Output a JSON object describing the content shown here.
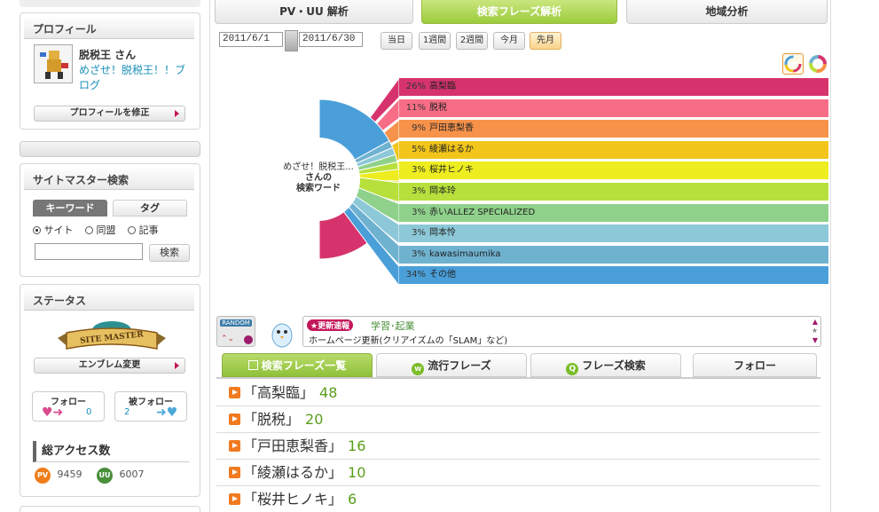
{
  "top_tabs": [
    {
      "label": "PV・UU 解析"
    },
    {
      "label": "検索フレーズ解析"
    },
    {
      "label": "地域分析"
    }
  ],
  "profile": {
    "title": "プロフィール",
    "name": "脱税王 さん",
    "blog_link": "めざせ！脱税王！！ブログ",
    "edit_button": "プロフィールを修正"
  },
  "sitemaster": {
    "title": "サイトマスター検索",
    "tab_keyword": "キーワード",
    "tab_tag": "タグ",
    "radio_site": "サイト",
    "radio_doumei": "同盟",
    "radio_kiji": "記事",
    "search_button": "検索",
    "search_value": ""
  },
  "status": {
    "title": "ステータス",
    "emblem_text": "SITE MASTER",
    "emblem_button": "エンブレム変更",
    "follow_label": "フォロー",
    "follow_count": "0",
    "followed_label": "被フォロー",
    "followed_count": "2",
    "access_title": "総アクセス数",
    "pv_badge": "PV",
    "pv_count": "9459",
    "uu_badge": "UU",
    "uu_count": "6007"
  },
  "date_range": {
    "from": "2011/6/1",
    "to": "2011/6/30"
  },
  "period_buttons": [
    "当日",
    "1週間",
    "2週間",
    "今月",
    "先月"
  ],
  "chart_center": {
    "line1": "めざせ！脱税王...",
    "line2": "さんの",
    "line3": "検索ワード"
  },
  "chart_data": {
    "type": "bar",
    "categories": [
      "高梨臨",
      "脱税",
      "戸田恵梨香",
      "綾瀬はるか",
      "桜井ヒノキ",
      "岡本玲",
      "赤いALLEZ SPECIALIZED",
      "岡本怜",
      "kawasimaumika",
      "その他"
    ],
    "values": [
      26,
      11,
      9,
      5,
      3,
      3,
      3,
      3,
      3,
      34
    ],
    "value_labels": [
      "26%",
      "11%",
      "9%",
      "5%",
      "3%",
      "3%",
      "3%",
      "3%",
      "3%",
      "34%"
    ],
    "colors": [
      "#d6336c",
      "#f76d85",
      "#f7924a",
      "#f2c51a",
      "#eded1f",
      "#b7e03c",
      "#8fd18b",
      "#8cc8d8",
      "#6fb2d0",
      "#4a9fd9"
    ]
  },
  "random": {
    "label": "RANDOM",
    "badge": "更新速報",
    "category": "学習･起業",
    "text": "ホームページ更新(クリアイズムの「SLAM」など)"
  },
  "sub_tabs": [
    {
      "label": "検索フレーズ一覧"
    },
    {
      "label": "流行フレーズ"
    },
    {
      "label": "フレーズ検索"
    },
    {
      "label": "フォロー"
    }
  ],
  "phrases": [
    {
      "text": "「高梨臨」",
      "count": "48"
    },
    {
      "text": "「脱税」",
      "count": "20"
    },
    {
      "text": "「戸田恵梨香」",
      "count": "16"
    },
    {
      "text": "「綾瀬はるか」",
      "count": "10"
    },
    {
      "text": "「桜井ヒノキ」",
      "count": "6"
    }
  ]
}
